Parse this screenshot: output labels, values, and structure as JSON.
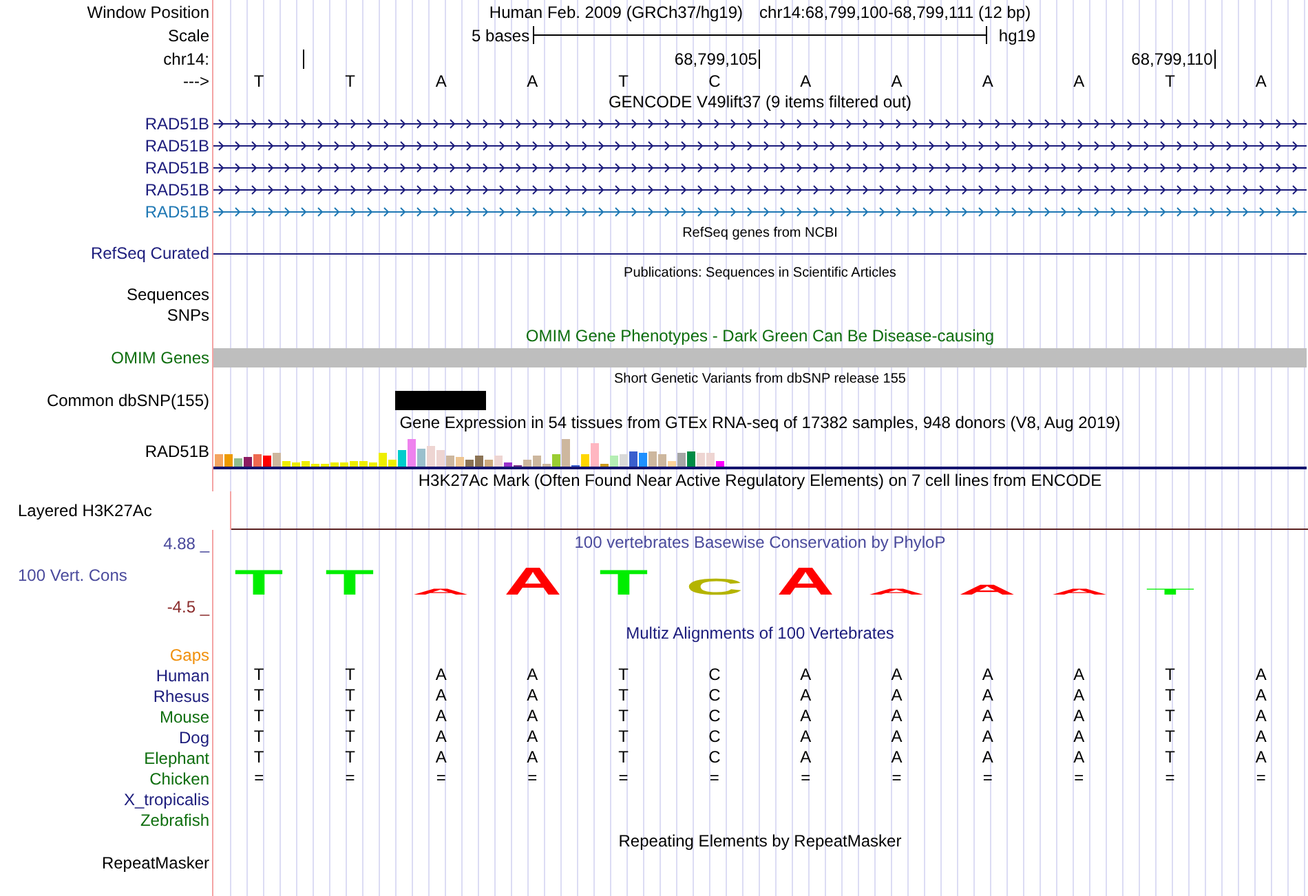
{
  "header": {
    "window_label": "Window Position",
    "assembly": "Human Feb. 2009 (GRCh37/hg19)",
    "position": "chr14:68,799,100-68,799,111 (12 bp)",
    "scale_label": "Scale",
    "scale_text": "5 bases",
    "scale_db": "hg19",
    "chrom_label": "chr14:",
    "ruler": [
      {
        "tick": true
      },
      {
        "tick": false
      },
      {
        "tick": false
      },
      {
        "tick": false
      },
      {
        "tick": false
      },
      {
        "tick": true,
        "label": "68,799,105"
      },
      {
        "tick": false
      },
      {
        "tick": false
      },
      {
        "tick": false
      },
      {
        "tick": false
      },
      {
        "tick": true,
        "label": "68,799,110"
      },
      {
        "tick": false
      }
    ],
    "strand_label": "--->",
    "bases": [
      "T",
      "T",
      "A",
      "A",
      "T",
      "C",
      "A",
      "A",
      "A",
      "A",
      "T",
      "A"
    ]
  },
  "tracks": [
    {
      "kind": "title",
      "text": "GENCODE V49lift37 (9 items filtered out)",
      "color": "#000000"
    },
    {
      "kind": "gene",
      "label": "RAD51B",
      "color": "#1c1c7c"
    },
    {
      "kind": "gene",
      "label": "RAD51B",
      "color": "#1c1c7c"
    },
    {
      "kind": "gene",
      "label": "RAD51B",
      "color": "#1c1c7c"
    },
    {
      "kind": "gene",
      "label": "RAD51B",
      "color": "#1c1c7c"
    },
    {
      "kind": "gene",
      "label": "RAD51B",
      "color": "#1f78b4"
    },
    {
      "kind": "subtitle",
      "text": "RefSeq genes from NCBI",
      "color": "#000000"
    },
    {
      "kind": "line",
      "label": "RefSeq Curated",
      "color": "#1c1c7c"
    },
    {
      "kind": "subtitle",
      "text": "Publications: Sequences in Scientific Articles",
      "color": "#000000"
    },
    {
      "kind": "empty",
      "label": "Sequences",
      "color": "#000000"
    },
    {
      "kind": "empty",
      "label": "SNPs",
      "color": "#000000"
    },
    {
      "kind": "title",
      "text": "OMIM Gene Phenotypes - Dark Green Can Be Disease-causing",
      "color": "#0e6e0e"
    },
    {
      "kind": "bar",
      "label": "OMIM Genes",
      "color": "#0e6e0e"
    },
    {
      "kind": "subtitle",
      "text": "Short Genetic Variants from dbSNP release 155",
      "color": "#000000"
    },
    {
      "kind": "variants",
      "label": "Common dbSNP(155)",
      "color": "#000000",
      "variants": [
        false,
        false,
        true,
        false,
        false,
        false,
        false,
        false,
        false,
        false,
        false,
        false
      ]
    },
    {
      "kind": "title",
      "text": "Gene Expression in 54 tissues from GTEx RNA-seq of 17382 samples, 948 donors (V8, Aug 2019)",
      "color": "#000000"
    },
    {
      "kind": "expression",
      "label": "RAD51B",
      "color": "#000000"
    },
    {
      "kind": "title",
      "text": "H3K27Ac Mark (Often Found Near Active Regulatory Elements) on 7 cell lines from ENCODE",
      "color": "#000000"
    },
    {
      "kind": "layered",
      "label": "Layered H3K27Ac",
      "color": "#000000"
    },
    {
      "kind": "conservation",
      "label": "100 Vert. Cons",
      "color": "#4a4a9c",
      "max": "4.88 _",
      "min": "-4.5 _",
      "title": "100 vertebrates Basewise Conservation by PhyloP",
      "letters": [
        {
          "base": "T",
          "color": "#00ee00"
        },
        {
          "base": "T",
          "color": "#00ee00"
        },
        {
          "base": "A",
          "color": "#ff0000"
        },
        {
          "base": "A",
          "color": "#ff0000"
        },
        {
          "base": "T",
          "color": "#00ee00"
        },
        {
          "base": "C",
          "color": "#b4b400"
        },
        {
          "base": "A",
          "color": "#ff0000"
        },
        {
          "base": "A",
          "color": "#ff0000"
        },
        {
          "base": "A",
          "color": "#ff0000"
        },
        {
          "base": "A",
          "color": "#ff0000"
        },
        {
          "base": "T",
          "color": "#00ee00"
        }
      ]
    },
    {
      "kind": "title",
      "text": "Multiz Alignments of 100 Vertebrates",
      "color": "#1c1c7c"
    },
    {
      "kind": "alignment",
      "label": "Gaps",
      "color": "#f0900c"
    },
    {
      "kind": "alignment",
      "label": "Human",
      "color": "#1c1c7c",
      "bases": [
        "T",
        "T",
        "A",
        "A",
        "T",
        "C",
        "A",
        "A",
        "A",
        "A",
        "T",
        "A"
      ]
    },
    {
      "kind": "alignment",
      "label": "Rhesus",
      "color": "#1c1c7c",
      "bases": [
        "T",
        "T",
        "A",
        "A",
        "T",
        "C",
        "A",
        "A",
        "A",
        "A",
        "T",
        "A"
      ]
    },
    {
      "kind": "alignment",
      "label": "Mouse",
      "color": "#0e6e0e",
      "bases": [
        "T",
        "T",
        "A",
        "A",
        "T",
        "C",
        "A",
        "A",
        "A",
        "A",
        "T",
        "A"
      ]
    },
    {
      "kind": "alignment",
      "label": "Dog",
      "color": "#1c1c7c",
      "bases": [
        "T",
        "T",
        "A",
        "A",
        "T",
        "C",
        "A",
        "A",
        "A",
        "A",
        "T",
        "A"
      ]
    },
    {
      "kind": "alignment",
      "label": "Elephant",
      "color": "#0e6e0e",
      "bases": [
        "T",
        "T",
        "A",
        "A",
        "T",
        "C",
        "A",
        "A",
        "A",
        "A",
        "T",
        "A"
      ]
    },
    {
      "kind": "alignment",
      "label": "Chicken",
      "color": "#0e6e0e",
      "bases": [
        "=",
        "=",
        "=",
        "=",
        "=",
        "=",
        "=",
        "=",
        "=",
        "=",
        "=",
        "="
      ]
    },
    {
      "kind": "alignment",
      "label": "X_tropicalis",
      "color": "#1c1c7c"
    },
    {
      "kind": "alignment",
      "label": "Zebrafish",
      "color": "#0e6e0e"
    },
    {
      "kind": "title",
      "text": "Repeating Elements by RepeatMasker",
      "color": "#000000"
    },
    {
      "kind": "empty",
      "label": "RepeatMasker",
      "color": "#000000"
    }
  ]
}
